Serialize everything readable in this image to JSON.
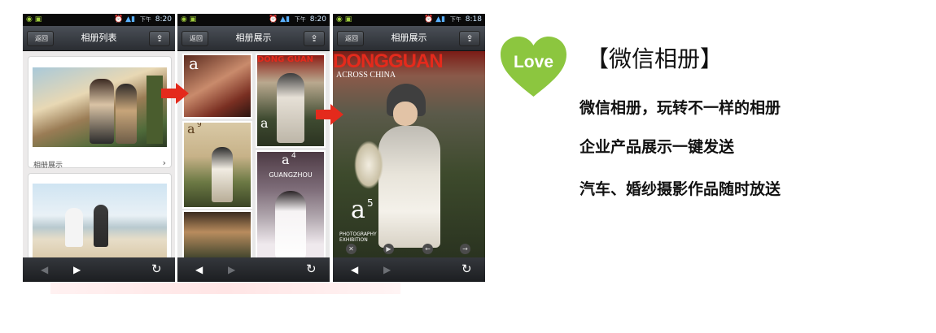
{
  "status_bar": {
    "time_1": "8:20",
    "time_2": "8:20",
    "time_3": "8:18",
    "period_label": "下午"
  },
  "screens": [
    {
      "back_label": "返回",
      "title": "相册列表"
    },
    {
      "back_label": "返回",
      "title": "相册展示"
    },
    {
      "back_label": "返回",
      "title": "相册展示"
    }
  ],
  "album_list": {
    "caption": "相册展示",
    "chevron": "›"
  },
  "magazine": {
    "masthead": "DONGGUAN",
    "subtitle": "ACROSS CHINA",
    "grid_masthead": "DONG GUAN",
    "issue": "a",
    "issue_sup": "5",
    "tile_issue_9": "9",
    "tile_issue_4": "4",
    "guangzhou": "GUANGZHOU",
    "photo_exhibition": "PHOTOGRAPHY EXHIBITION"
  },
  "promo": {
    "love_badge": "Love",
    "headline": "【微信相册】",
    "lines": [
      "微信相册，玩转不一样的相册",
      "企业产品展示一键发送",
      "汽车、婚纱摄影作品随时放送"
    ]
  },
  "icons": {
    "back_nav": "◀",
    "forward_nav": "▶",
    "refresh": "↻",
    "share": "share-icon",
    "transition_arrow": "red-arrow-icon"
  },
  "colors": {
    "accent_red": "#e42a1c",
    "love_green": "#8cc63f"
  }
}
